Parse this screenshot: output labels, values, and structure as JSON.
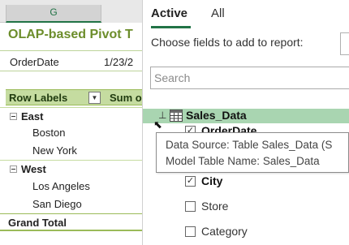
{
  "sheet": {
    "column_header": "G",
    "title": "OLAP-based Pivot T",
    "filter": {
      "label": "OrderDate",
      "value": "1/23/2"
    },
    "header": {
      "row_labels": "Row Labels",
      "sum_label": "Sum o"
    },
    "groups": [
      {
        "name": "East",
        "items": [
          "Boston",
          "New York"
        ]
      },
      {
        "name": "West",
        "items": [
          "Los Angeles",
          "San Diego"
        ]
      }
    ],
    "grand_total": "Grand Total"
  },
  "fields_pane": {
    "tabs": {
      "active": "Active",
      "all": "All"
    },
    "instruction": "Choose fields to add to report:",
    "search": {
      "placeholder": "Search",
      "value": ""
    },
    "table": {
      "name": "Sales_Data",
      "expander": "⊥"
    },
    "fields": {
      "order_date": "OrderDate",
      "city": "City",
      "store": "Store",
      "category": "Category"
    },
    "tooltip": {
      "line1": "Data Source: Table Sales_Data (S",
      "line2": "Model Table Name: Sales_Data"
    }
  },
  "colors": {
    "title_green": "#6c8d2b",
    "header_fill": "#c5dca0",
    "accent": "#217346",
    "table_row": "#a9d5b1"
  }
}
